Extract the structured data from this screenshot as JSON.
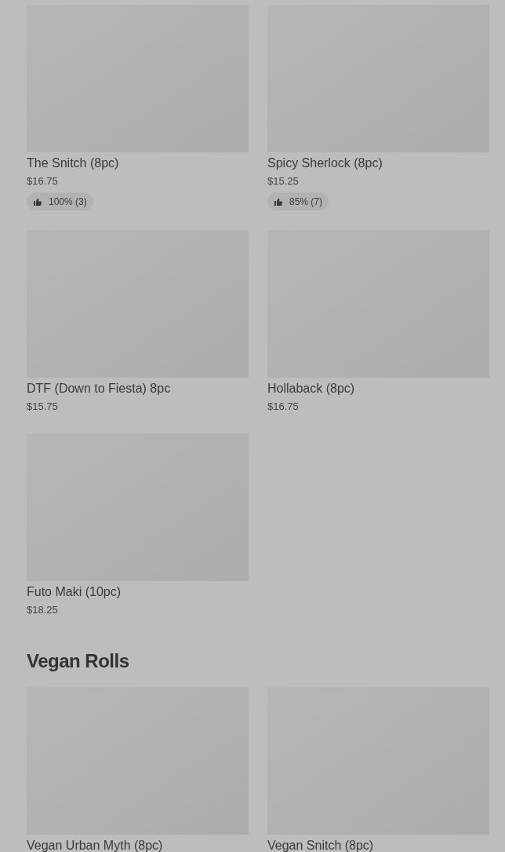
{
  "sections": [
    {
      "items": [
        {
          "name": "The Snitch (8pc)",
          "price": "$16.75",
          "rating": "100% (3)"
        },
        {
          "name": "Spicy Sherlock (8pc)",
          "price": "$15.25",
          "rating": "85% (7)"
        },
        {
          "name": "DTF (Down to Fiesta) 8pc",
          "price": "$15.75"
        },
        {
          "name": "Hollaback (8pc)",
          "price": "$16.75"
        },
        {
          "name": "Futo Maki (10pc)",
          "price": "$18.25"
        }
      ]
    },
    {
      "title": "Vegan Rolls",
      "items": [
        {
          "name": "Vegan Urban Myth (8pc)"
        },
        {
          "name": "Vegan Snitch (8pc)"
        }
      ]
    }
  ]
}
